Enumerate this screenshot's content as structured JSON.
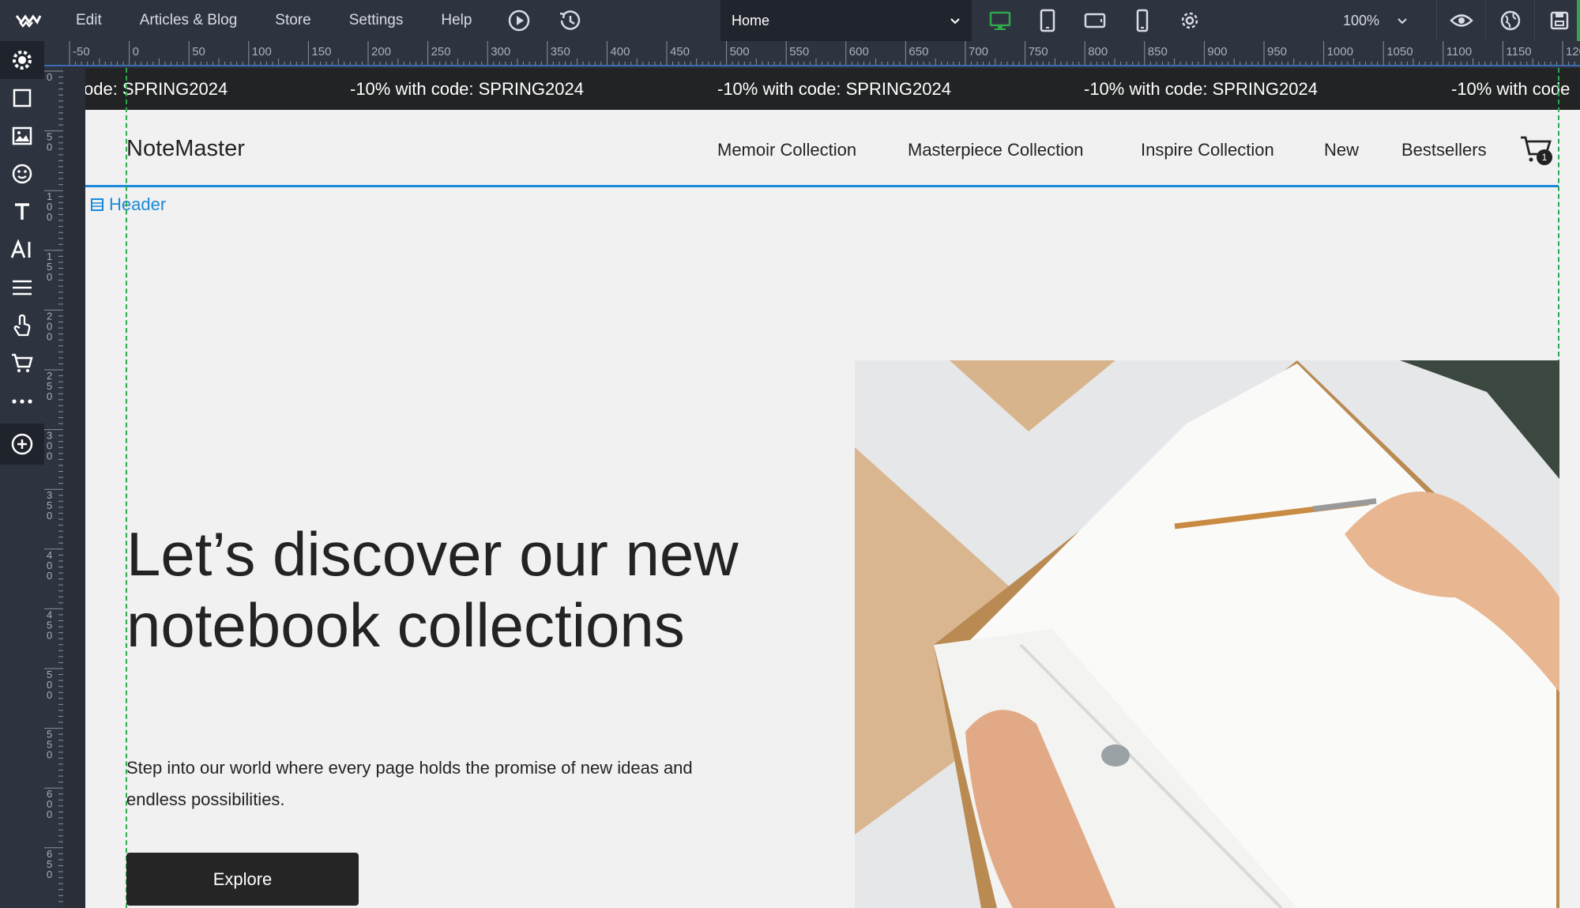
{
  "toolbar": {
    "menu": [
      "Edit",
      "Articles & Blog",
      "Store",
      "Settings",
      "Help"
    ],
    "page_selected": "Home",
    "zoom": "100%"
  },
  "ruler_h_labels": [
    "-50",
    "0",
    "50",
    "100",
    "150",
    "200",
    "250",
    "300",
    "350",
    "400",
    "450",
    "500",
    "550",
    "600",
    "650",
    "700",
    "750",
    "800",
    "850",
    "900",
    "950",
    "1000",
    "1050",
    "1100",
    "1150",
    "120"
  ],
  "ruler_v_labels": [
    "0",
    "50",
    "100",
    "150",
    "200",
    "250",
    "300",
    "350",
    "400",
    "450",
    "500",
    "550",
    "600",
    "650"
  ],
  "promo": {
    "items": [
      "ode: SPRING2024",
      "-10% with code: SPRING2024",
      "-10% with code: SPRING2024",
      "-10% with code: SPRING2024",
      "-10% with code"
    ]
  },
  "site": {
    "brand": "NoteMaster",
    "nav": [
      "Memoir Collection",
      "Masterpiece Collection",
      "Inspire Collection",
      "New",
      "Bestsellers"
    ],
    "cart_count": "1",
    "section_label": "Header"
  },
  "hero": {
    "title": "Let’s discover our new notebook collections",
    "subtitle": "Step into our world where every page holds the promise of new ideas and endless possibilities.",
    "button": "Explore"
  },
  "colors": {
    "toolbar_bg": "#2e3340",
    "accent_blue": "#1a8ad9",
    "accent_green": "#2ea84a",
    "promo_bg": "#222324",
    "button_bg": "#252525"
  }
}
